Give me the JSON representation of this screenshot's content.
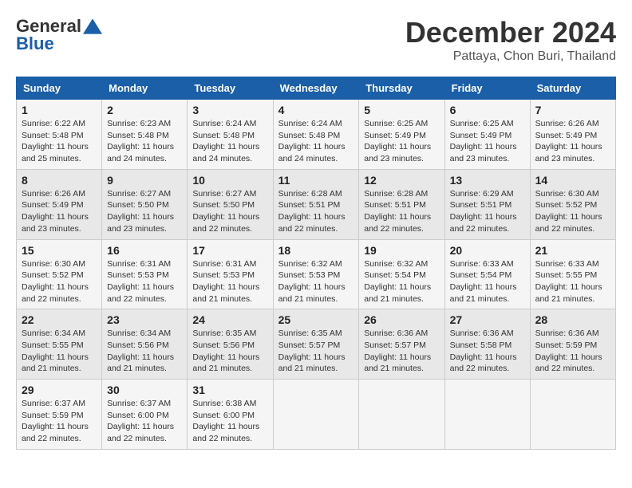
{
  "header": {
    "logo_general": "General",
    "logo_blue": "Blue",
    "month_title": "December 2024",
    "location": "Pattaya, Chon Buri, Thailand"
  },
  "calendar": {
    "days_of_week": [
      "Sunday",
      "Monday",
      "Tuesday",
      "Wednesday",
      "Thursday",
      "Friday",
      "Saturday"
    ],
    "weeks": [
      [
        null,
        {
          "day": "2",
          "sunrise": "6:23 AM",
          "sunset": "5:48 PM",
          "daylight": "11 hours and 24 minutes."
        },
        {
          "day": "3",
          "sunrise": "6:24 AM",
          "sunset": "5:48 PM",
          "daylight": "11 hours and 24 minutes."
        },
        {
          "day": "4",
          "sunrise": "6:24 AM",
          "sunset": "5:48 PM",
          "daylight": "11 hours and 24 minutes."
        },
        {
          "day": "5",
          "sunrise": "6:25 AM",
          "sunset": "5:49 PM",
          "daylight": "11 hours and 23 minutes."
        },
        {
          "day": "6",
          "sunrise": "6:25 AM",
          "sunset": "5:49 PM",
          "daylight": "11 hours and 23 minutes."
        },
        {
          "day": "7",
          "sunrise": "6:26 AM",
          "sunset": "5:49 PM",
          "daylight": "11 hours and 23 minutes."
        }
      ],
      [
        {
          "day": "1",
          "sunrise": "6:22 AM",
          "sunset": "5:48 PM",
          "daylight": "11 hours and 25 minutes."
        },
        null,
        null,
        null,
        null,
        null,
        null
      ],
      [
        {
          "day": "8",
          "sunrise": "6:26 AM",
          "sunset": "5:49 PM",
          "daylight": "11 hours and 23 minutes."
        },
        {
          "day": "9",
          "sunrise": "6:27 AM",
          "sunset": "5:50 PM",
          "daylight": "11 hours and 23 minutes."
        },
        {
          "day": "10",
          "sunrise": "6:27 AM",
          "sunset": "5:50 PM",
          "daylight": "11 hours and 22 minutes."
        },
        {
          "day": "11",
          "sunrise": "6:28 AM",
          "sunset": "5:51 PM",
          "daylight": "11 hours and 22 minutes."
        },
        {
          "day": "12",
          "sunrise": "6:28 AM",
          "sunset": "5:51 PM",
          "daylight": "11 hours and 22 minutes."
        },
        {
          "day": "13",
          "sunrise": "6:29 AM",
          "sunset": "5:51 PM",
          "daylight": "11 hours and 22 minutes."
        },
        {
          "day": "14",
          "sunrise": "6:30 AM",
          "sunset": "5:52 PM",
          "daylight": "11 hours and 22 minutes."
        }
      ],
      [
        {
          "day": "15",
          "sunrise": "6:30 AM",
          "sunset": "5:52 PM",
          "daylight": "11 hours and 22 minutes."
        },
        {
          "day": "16",
          "sunrise": "6:31 AM",
          "sunset": "5:53 PM",
          "daylight": "11 hours and 22 minutes."
        },
        {
          "day": "17",
          "sunrise": "6:31 AM",
          "sunset": "5:53 PM",
          "daylight": "11 hours and 21 minutes."
        },
        {
          "day": "18",
          "sunrise": "6:32 AM",
          "sunset": "5:53 PM",
          "daylight": "11 hours and 21 minutes."
        },
        {
          "day": "19",
          "sunrise": "6:32 AM",
          "sunset": "5:54 PM",
          "daylight": "11 hours and 21 minutes."
        },
        {
          "day": "20",
          "sunrise": "6:33 AM",
          "sunset": "5:54 PM",
          "daylight": "11 hours and 21 minutes."
        },
        {
          "day": "21",
          "sunrise": "6:33 AM",
          "sunset": "5:55 PM",
          "daylight": "11 hours and 21 minutes."
        }
      ],
      [
        {
          "day": "22",
          "sunrise": "6:34 AM",
          "sunset": "5:55 PM",
          "daylight": "11 hours and 21 minutes."
        },
        {
          "day": "23",
          "sunrise": "6:34 AM",
          "sunset": "5:56 PM",
          "daylight": "11 hours and 21 minutes."
        },
        {
          "day": "24",
          "sunrise": "6:35 AM",
          "sunset": "5:56 PM",
          "daylight": "11 hours and 21 minutes."
        },
        {
          "day": "25",
          "sunrise": "6:35 AM",
          "sunset": "5:57 PM",
          "daylight": "11 hours and 21 minutes."
        },
        {
          "day": "26",
          "sunrise": "6:36 AM",
          "sunset": "5:57 PM",
          "daylight": "11 hours and 21 minutes."
        },
        {
          "day": "27",
          "sunrise": "6:36 AM",
          "sunset": "5:58 PM",
          "daylight": "11 hours and 22 minutes."
        },
        {
          "day": "28",
          "sunrise": "6:36 AM",
          "sunset": "5:59 PM",
          "daylight": "11 hours and 22 minutes."
        }
      ],
      [
        {
          "day": "29",
          "sunrise": "6:37 AM",
          "sunset": "5:59 PM",
          "daylight": "11 hours and 22 minutes."
        },
        {
          "day": "30",
          "sunrise": "6:37 AM",
          "sunset": "6:00 PM",
          "daylight": "11 hours and 22 minutes."
        },
        {
          "day": "31",
          "sunrise": "6:38 AM",
          "sunset": "6:00 PM",
          "daylight": "11 hours and 22 minutes."
        },
        null,
        null,
        null,
        null
      ]
    ]
  }
}
